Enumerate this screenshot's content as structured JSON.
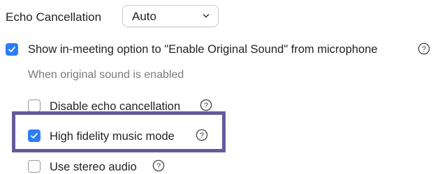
{
  "echo_cancellation": {
    "label": "Echo Cancellation",
    "select_value": "Auto"
  },
  "original_sound_option": {
    "label": "Show in-meeting option to \"Enable Original Sound\" from microphone",
    "checked": true
  },
  "sub_heading": "When original sound is enabled",
  "sub_options": [
    {
      "label": "Disable echo cancellation",
      "checked": false
    },
    {
      "label": "High fidelity music mode",
      "checked": true,
      "highlighted": true
    },
    {
      "label": "Use stereo audio",
      "checked": false
    }
  ],
  "colors": {
    "accent": "#2c7cf6",
    "highlight_border": "#675a9c",
    "muted_text": "#7b7b7b"
  },
  "icons": {
    "help": "question-circle-icon",
    "check": "checkmark-icon",
    "chevron": "chevron-down-icon"
  }
}
